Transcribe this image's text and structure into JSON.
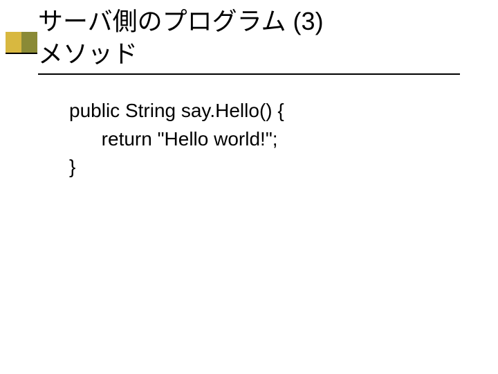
{
  "title": {
    "line1": "サーバ側のプログラム (3)",
    "line2": "メソッド"
  },
  "code": {
    "line1": "public String say.Hello() {",
    "line2": "      return \"Hello world!\";",
    "line3": "}"
  }
}
